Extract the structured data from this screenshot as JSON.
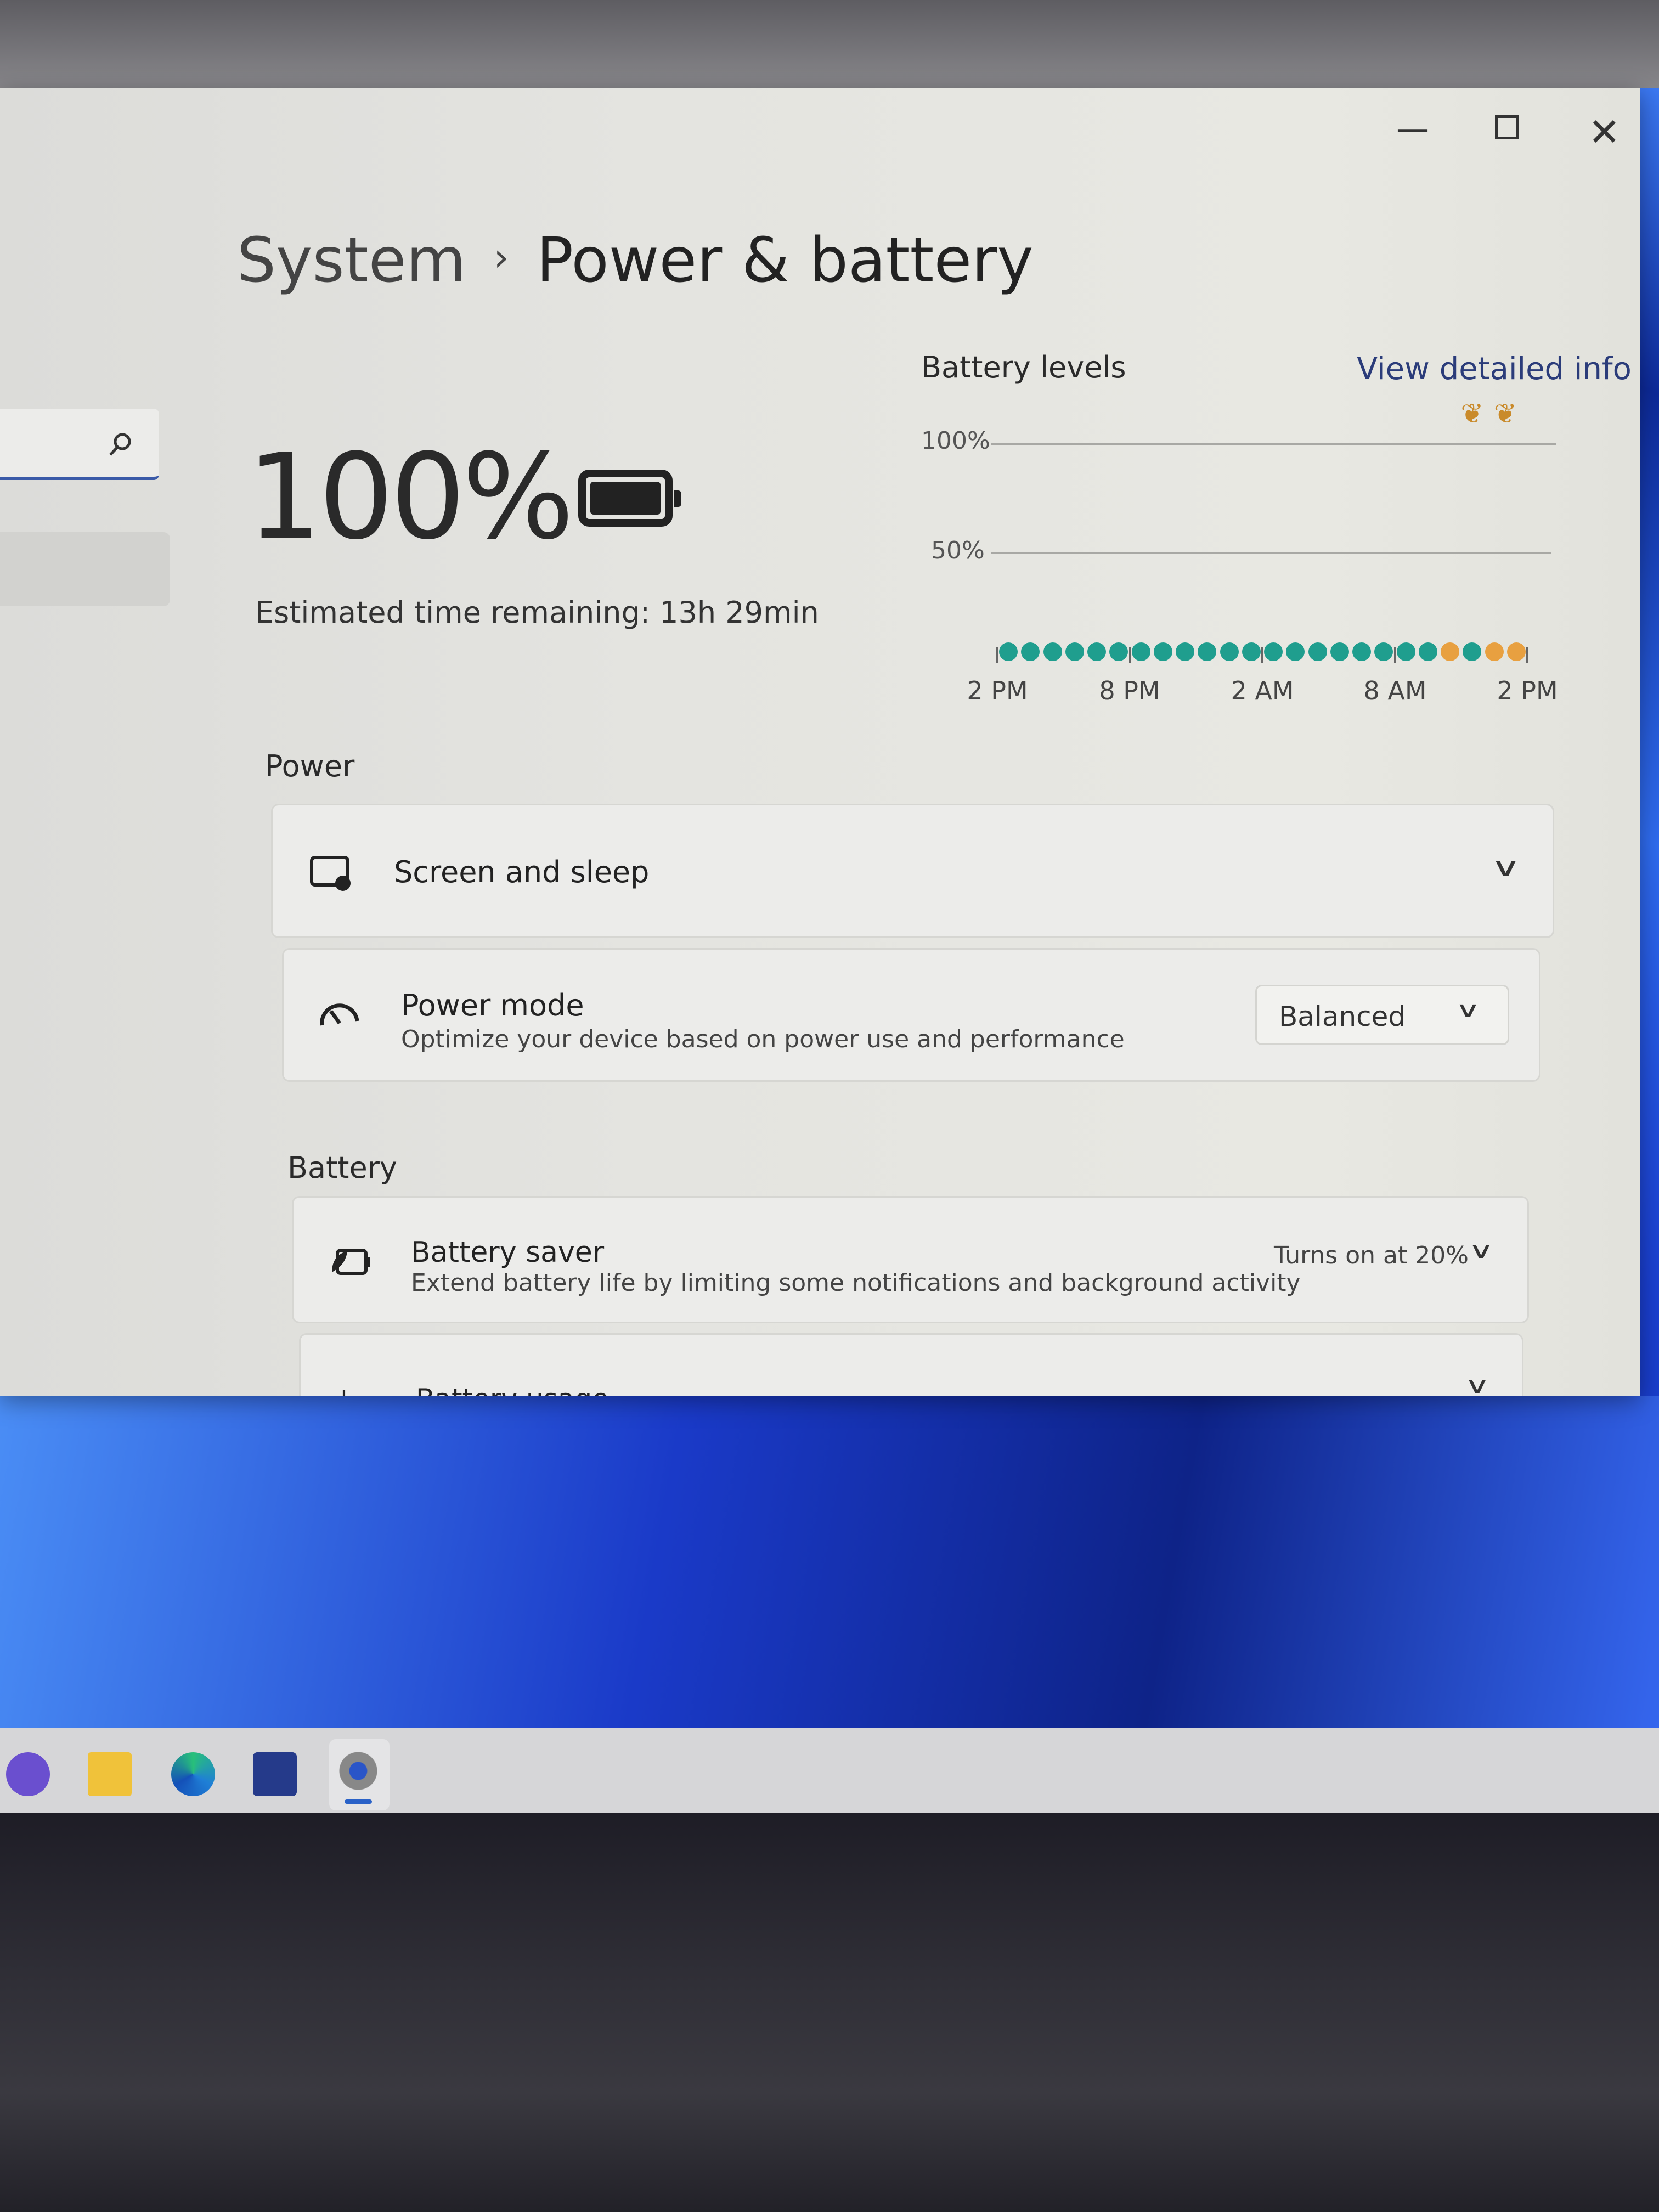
{
  "window": {
    "minimize_icon": "minimize-icon",
    "maximize_icon": "maximize-icon",
    "close_icon": "close-icon"
  },
  "breadcrumb": {
    "parent": "System",
    "separator": "›",
    "current": "Power & battery"
  },
  "search": {
    "icon": "search-icon"
  },
  "battery": {
    "percent": "100%",
    "level": 1.0,
    "estimate": "Estimated time remaining: 13h 29min"
  },
  "chart_data": {
    "type": "scatter",
    "title": "Battery levels",
    "link": "View detailed info",
    "y_ticks": [
      "100%",
      "50%"
    ],
    "x_ticks": [
      "2 PM",
      "8 PM",
      "2 AM",
      "8 AM",
      "2 PM"
    ],
    "ylim": [
      0,
      100
    ],
    "grid": true,
    "points": [
      {
        "hour": 0,
        "state": "plugged",
        "color": "#1f9e8e"
      },
      {
        "hour": 1,
        "state": "plugged",
        "color": "#1f9e8e"
      },
      {
        "hour": 2,
        "state": "plugged",
        "color": "#1f9e8e"
      },
      {
        "hour": 3,
        "state": "plugged",
        "color": "#1f9e8e"
      },
      {
        "hour": 4,
        "state": "plugged",
        "color": "#1f9e8e"
      },
      {
        "hour": 5,
        "state": "plugged",
        "color": "#1f9e8e"
      },
      {
        "hour": 6,
        "state": "plugged",
        "color": "#1f9e8e"
      },
      {
        "hour": 7,
        "state": "plugged",
        "color": "#1f9e8e"
      },
      {
        "hour": 8,
        "state": "plugged",
        "color": "#1f9e8e"
      },
      {
        "hour": 9,
        "state": "plugged",
        "color": "#1f9e8e"
      },
      {
        "hour": 10,
        "state": "plugged",
        "color": "#1f9e8e"
      },
      {
        "hour": 11,
        "state": "plugged",
        "color": "#1f9e8e"
      },
      {
        "hour": 12,
        "state": "plugged",
        "color": "#1f9e8e"
      },
      {
        "hour": 13,
        "state": "plugged",
        "color": "#1f9e8e"
      },
      {
        "hour": 14,
        "state": "plugged",
        "color": "#1f9e8e"
      },
      {
        "hour": 15,
        "state": "plugged",
        "color": "#1f9e8e"
      },
      {
        "hour": 16,
        "state": "plugged",
        "color": "#1f9e8e"
      },
      {
        "hour": 17,
        "state": "plugged",
        "color": "#1f9e8e"
      },
      {
        "hour": 18,
        "state": "plugged",
        "color": "#1f9e8e"
      },
      {
        "hour": 19,
        "state": "plugged",
        "color": "#1f9e8e"
      },
      {
        "hour": 20,
        "state": "low-carbon",
        "color": "#e8a040"
      },
      {
        "hour": 21,
        "state": "plugged",
        "color": "#1f9e8e"
      },
      {
        "hour": 22,
        "state": "low-carbon",
        "color": "#e8a040"
      },
      {
        "hour": 23,
        "state": "low-carbon",
        "color": "#e8a040"
      }
    ],
    "leaf_markers_at_hours": [
      21,
      22.5
    ]
  },
  "power": {
    "header": "Power",
    "screen_sleep": {
      "label": "Screen and sleep",
      "icon": "screen-sleep-icon"
    },
    "power_mode": {
      "label": "Power mode",
      "description": "Optimize your device based on power use and performance",
      "value": "Balanced",
      "icon": "gauge-icon"
    }
  },
  "battery_section": {
    "header": "Battery",
    "saver": {
      "label": "Battery saver",
      "description": "Extend battery life by limiting some notifications and background activity",
      "status": "Turns on at 20%",
      "icon": "battery-saver-icon"
    },
    "usage": {
      "label": "Battery usage",
      "icon": "chart-icon"
    }
  },
  "taskbar": {
    "items": [
      "chat-icon",
      "file-explorer-icon",
      "edge-icon",
      "store-icon",
      "settings-icon"
    ]
  }
}
